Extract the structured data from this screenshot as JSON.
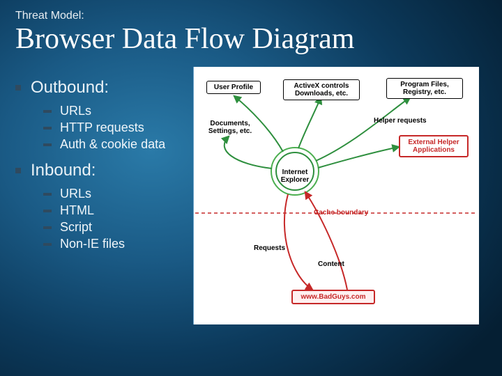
{
  "pretitle": "Threat Model:",
  "title": "Browser Data Flow Diagram",
  "sections": [
    {
      "heading": "Outbound:",
      "items": [
        "URLs",
        "HTTP requests",
        "Auth & cookie data"
      ]
    },
    {
      "heading": "Inbound:",
      "items": [
        "URLs",
        "HTML",
        "Script",
        "Non-IE files"
      ]
    }
  ],
  "diagram": {
    "boxes": {
      "user_profile": "User Profile",
      "activex": "ActiveX controls Downloads, etc.",
      "program_files": "Program Files, Registry, etc.",
      "external_helper": "External Helper Applications",
      "badguys": "www.BadGuys.com"
    },
    "labels": {
      "docs": "Documents, Settings, etc.",
      "helper_requests": "Helper requests",
      "ie": "Internet Explorer",
      "requests": "Requests",
      "content": "Content",
      "cache_boundary": "Cache boundary"
    }
  }
}
